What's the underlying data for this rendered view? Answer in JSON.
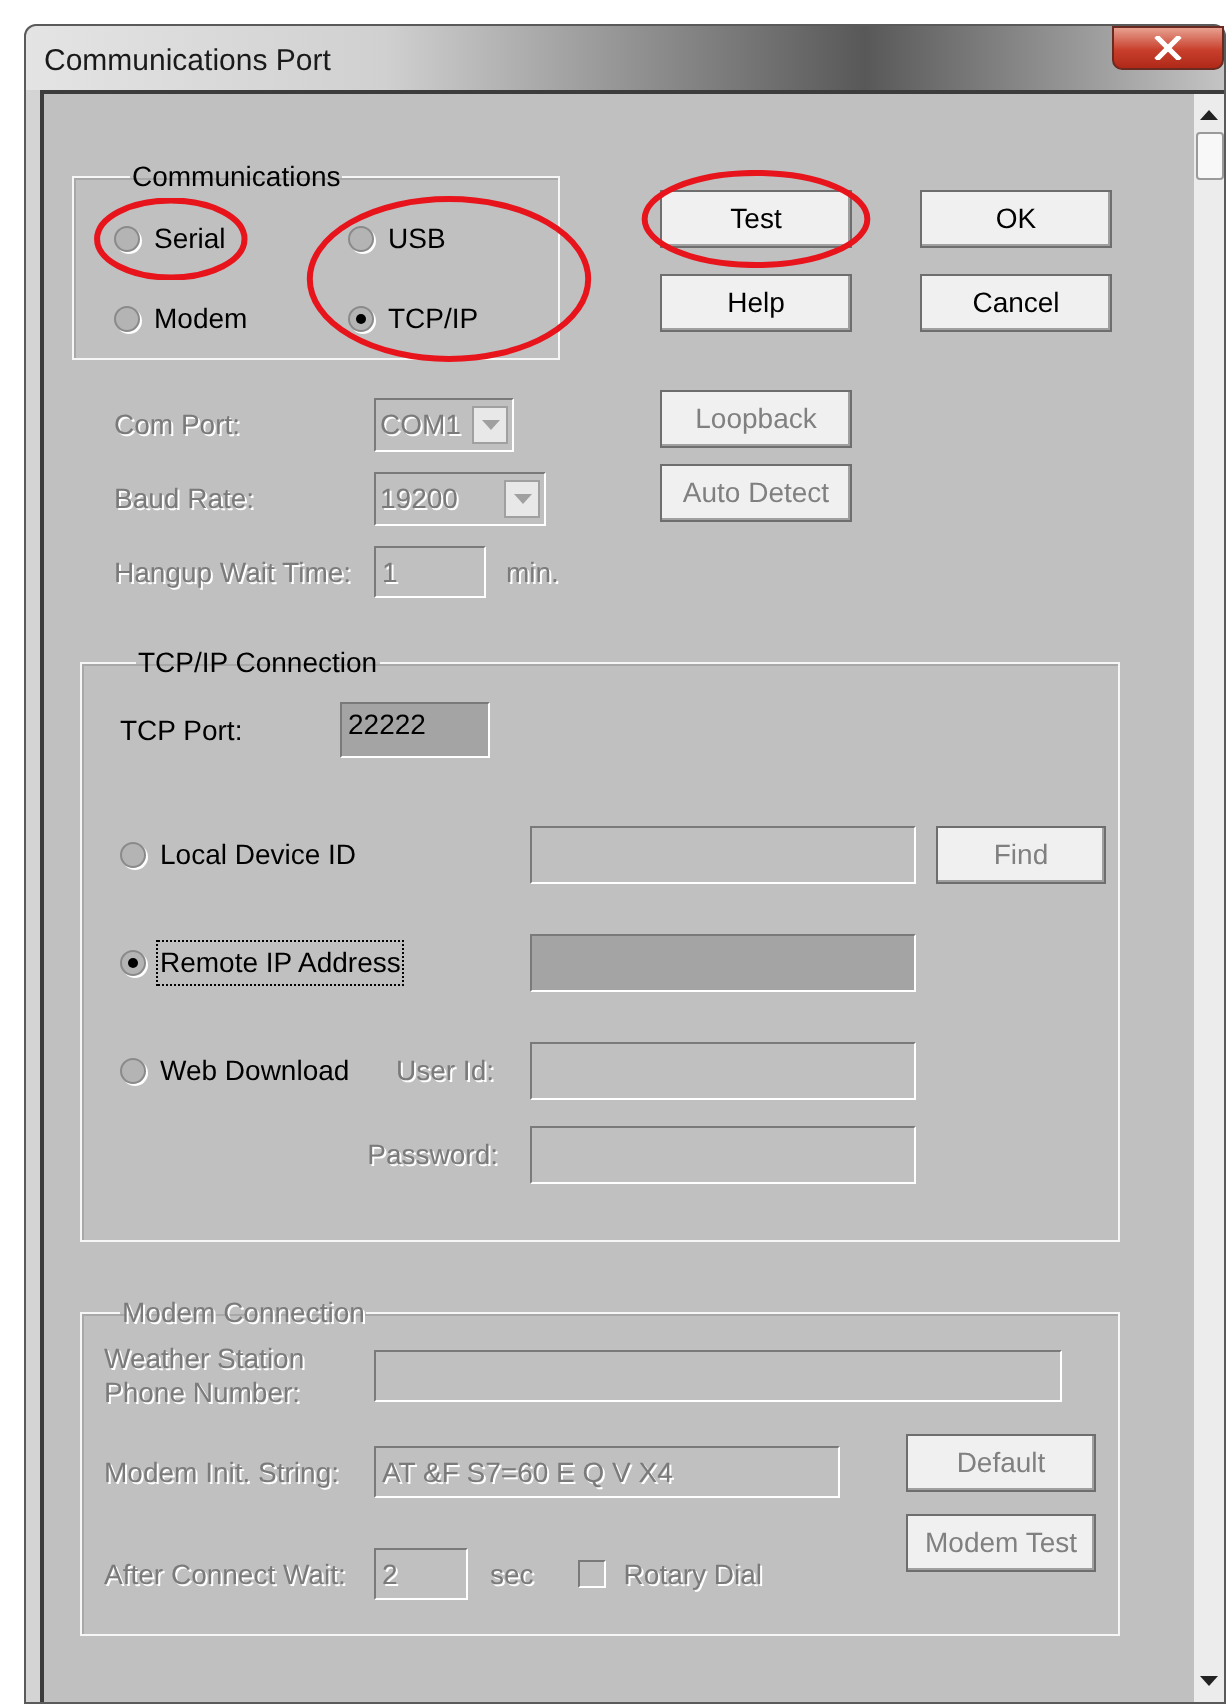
{
  "window": {
    "title": "Communications Port"
  },
  "communications": {
    "legend": "Communications",
    "columns": [
      {
        "circled": false,
        "options": [
          {
            "label": "Serial",
            "selected": false,
            "circled": true
          },
          {
            "label": "Modem",
            "selected": false,
            "circled": false
          }
        ]
      },
      {
        "circled": true,
        "options": [
          {
            "label": "USB",
            "selected": false,
            "circled": false
          },
          {
            "label": "TCP/IP",
            "selected": true,
            "circled": false
          }
        ]
      }
    ]
  },
  "buttons": [
    {
      "label": "Test",
      "disabled": false,
      "circled": true
    },
    {
      "label": "OK",
      "disabled": false,
      "circled": false
    },
    {
      "label": "Help",
      "disabled": false,
      "circled": false
    },
    {
      "label": "Cancel",
      "disabled": false,
      "circled": false
    }
  ],
  "serial": {
    "disabled": true,
    "fields": [
      {
        "kind": "combo",
        "label": "Com Port:",
        "value": "COM1"
      },
      {
        "kind": "combo",
        "label": "Baud Rate:",
        "value": "19200"
      },
      {
        "kind": "text",
        "label": "Hangup Wait Time:",
        "value": "1",
        "unit": "min."
      }
    ],
    "buttons": [
      {
        "label": "Loopback",
        "disabled": true
      },
      {
        "label": "Auto Detect",
        "disabled": true
      }
    ]
  },
  "tcpip": {
    "legend": "TCP/IP Connection",
    "port_label": "TCP Port:",
    "port_value": "22222",
    "options": [
      {
        "label": "Local Device ID",
        "selected": false,
        "focused": false,
        "field_disabled": true
      },
      {
        "label": "Remote IP Address",
        "selected": true,
        "focused": true,
        "field_disabled": false
      },
      {
        "label": "Web Download",
        "selected": false,
        "focused": false,
        "field_disabled": true
      }
    ],
    "find_button": {
      "label": "Find",
      "disabled": true
    },
    "user_id_label": "User Id:",
    "password_label": "Password:"
  },
  "modem": {
    "legend": "Modem Connection",
    "disabled": true,
    "phone_label": "Weather Station",
    "phone_label_2": "Phone Number:",
    "init_label": "Modem Init. String:",
    "init_value": "AT &F S7=60 E Q V X4",
    "wait_label": "After Connect Wait:",
    "wait_value": "2",
    "wait_unit": "sec",
    "rotary": {
      "label": "Rotary Dial",
      "checked": false
    },
    "buttons": [
      {
        "label": "Default",
        "disabled": true
      },
      {
        "label": "Modem Test",
        "disabled": true
      }
    ]
  }
}
